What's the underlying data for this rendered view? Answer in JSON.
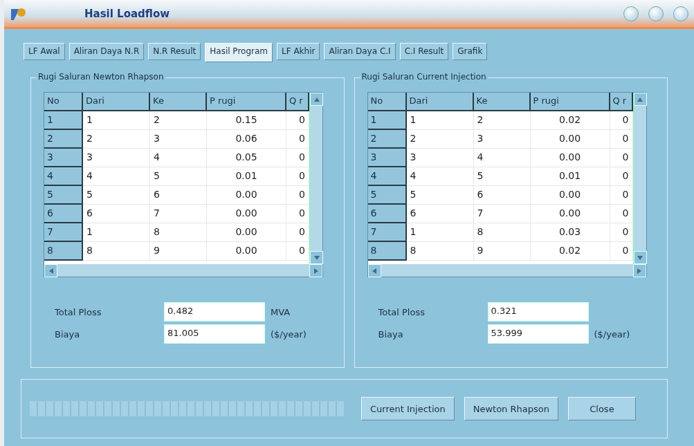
{
  "window": {
    "title": "Hasil Loadflow"
  },
  "tabs": [
    {
      "label": "LF Awal",
      "selected": false
    },
    {
      "label": "Aliran Daya N.R",
      "selected": false
    },
    {
      "label": "N.R Result",
      "selected": false
    },
    {
      "label": "Hasil Program",
      "selected": true
    },
    {
      "label": "LF Akhir",
      "selected": false
    },
    {
      "label": "Aliran Daya C.I",
      "selected": false
    },
    {
      "label": "C.I Result",
      "selected": false
    },
    {
      "label": "Grafik",
      "selected": false
    }
  ],
  "groups": [
    {
      "title": "Rugi Saluran Newton Rhapson",
      "columns": [
        "No",
        "Dari",
        "Ke",
        "P rugi",
        "Q r"
      ],
      "rows": [
        [
          "1",
          "1",
          "2",
          "0.15",
          "0"
        ],
        [
          "2",
          "2",
          "3",
          "0.06",
          "0"
        ],
        [
          "3",
          "3",
          "4",
          "0.05",
          "0"
        ],
        [
          "4",
          "4",
          "5",
          "0.01",
          "0"
        ],
        [
          "5",
          "5",
          "6",
          "0.00",
          "0"
        ],
        [
          "6",
          "6",
          "7",
          "0.00",
          "0"
        ],
        [
          "7",
          "1",
          "8",
          "0.00",
          "0"
        ],
        [
          "8",
          "8",
          "9",
          "0.00",
          "0"
        ]
      ],
      "total_ploss": {
        "label": "Total Ploss",
        "value": "0.482",
        "unit": "MVA"
      },
      "biaya": {
        "label": "Biaya",
        "value": "81.005",
        "unit": "($/year)"
      }
    },
    {
      "title": "Rugi Saluran Current Injection",
      "columns": [
        "No",
        "Dari",
        "Ke",
        "P rugi",
        "Q r"
      ],
      "rows": [
        [
          "1",
          "1",
          "2",
          "0.02",
          "0"
        ],
        [
          "2",
          "2",
          "3",
          "0.00",
          "0"
        ],
        [
          "3",
          "3",
          "4",
          "0.00",
          "0"
        ],
        [
          "4",
          "4",
          "5",
          "0.01",
          "0"
        ],
        [
          "5",
          "5",
          "6",
          "0.00",
          "0"
        ],
        [
          "6",
          "6",
          "7",
          "0.00",
          "0"
        ],
        [
          "7",
          "1",
          "8",
          "0.03",
          "0"
        ],
        [
          "8",
          "8",
          "9",
          "0.02",
          "0"
        ]
      ],
      "total_ploss": {
        "label": "Total Ploss",
        "value": "0.321"
      },
      "biaya": {
        "label": "Biaya",
        "value": "53.999",
        "unit": "($/year)"
      }
    }
  ],
  "progress": {
    "level": 1
  },
  "buttons": [
    "Current Injection",
    "Newton Rhapson",
    "Close"
  ]
}
